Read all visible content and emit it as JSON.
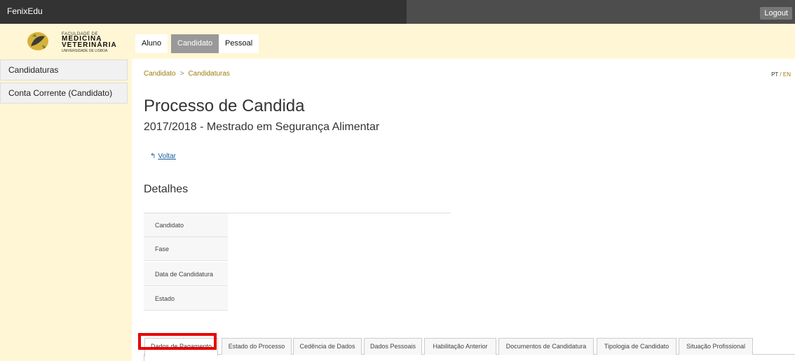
{
  "topbar": {
    "brand": "FenixEdu",
    "logout": "Logout"
  },
  "logo": {
    "line1": "FACULDADE DE",
    "line2": "MEDICINA",
    "line3": "VETERINÁRIA",
    "line4": "UNIVERSIDADE DE LISBOA"
  },
  "sidebar": {
    "items": [
      "Candidaturas",
      "Conta Corrente (Candidato)"
    ]
  },
  "top_tabs": {
    "aluno": "Aluno",
    "candidato": "Candidato",
    "pessoal": "Pessoal"
  },
  "breadcrumb": {
    "root": "Candidato",
    "sep": ">",
    "current": "Candidaturas"
  },
  "lang": {
    "pt": "PT",
    "sep": "/",
    "en": "EN"
  },
  "page": {
    "title": "Processo de Candidatura",
    "subtitle": "2017/2018 - Mestrado em Segurança Alimentar",
    "back": "Voltar",
    "section": "Detalhes"
  },
  "details": [
    "Candidato",
    "Fase",
    "Data de Candidatura",
    "Estado"
  ],
  "tabs": [
    "Dados de Pagamento",
    "Estado do Processo",
    "Cedência de Dados",
    "Dados Pessoais",
    "Habilitação Anterior",
    "Documentos de Candidatura",
    "Tipologia de Candidato",
    "Situação Profissional"
  ],
  "colors": {
    "accent": "#9a7d10",
    "sidebar_bg": "#fff6d5",
    "highlight": "#e80000"
  }
}
